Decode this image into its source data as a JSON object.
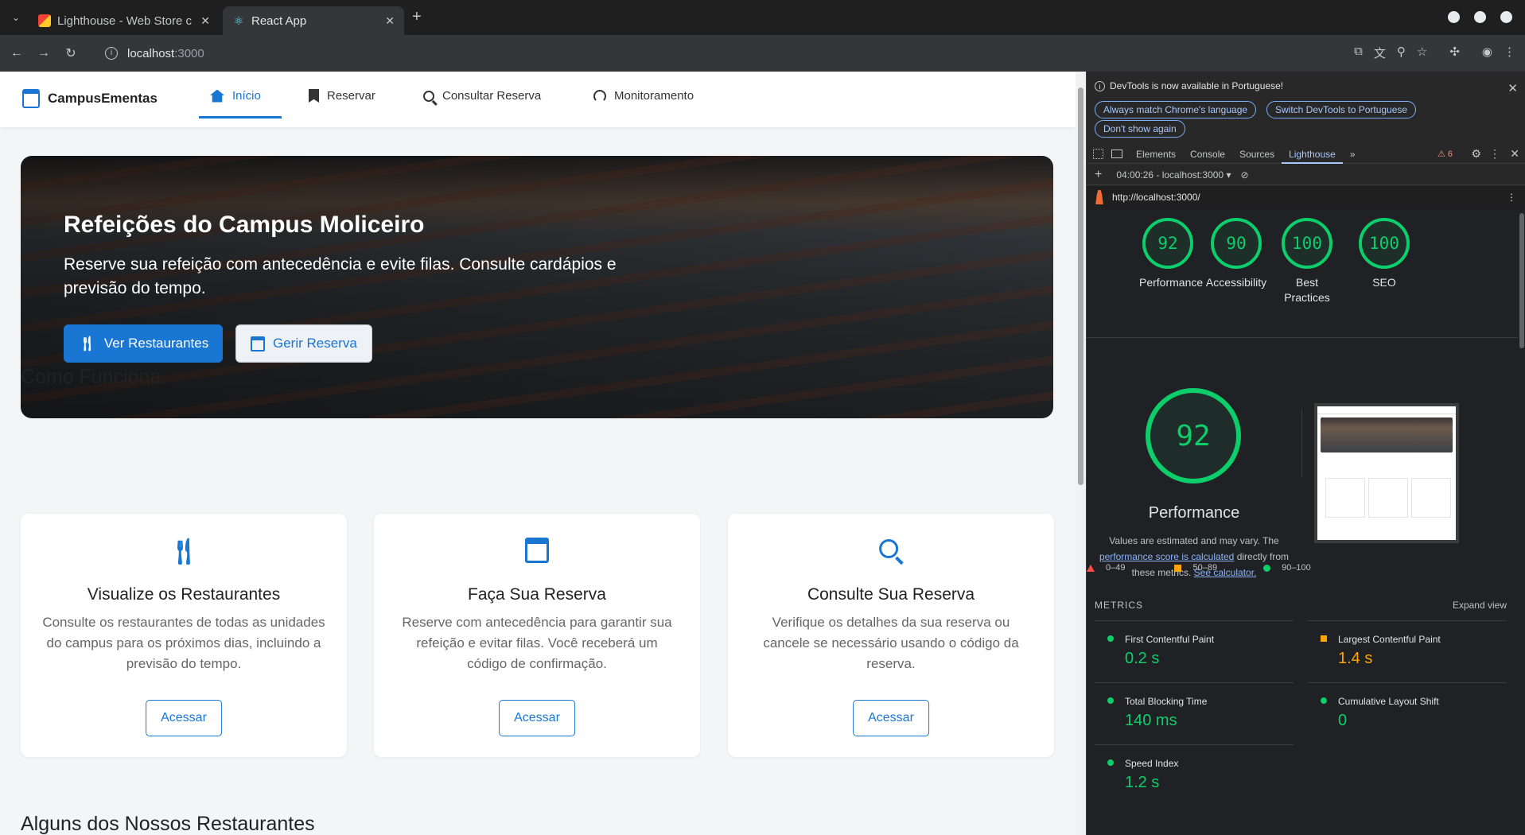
{
  "browser": {
    "tabs": [
      {
        "title": "Lighthouse - Web Store c",
        "active": false
      },
      {
        "title": "React App",
        "active": true
      }
    ],
    "url_host": "localhost",
    "url_port": ":3000"
  },
  "app": {
    "brand": "CampusEmentas",
    "nav": [
      {
        "label": "Início",
        "active": true
      },
      {
        "label": "Reservar",
        "active": false
      },
      {
        "label": "Consultar Reserva",
        "active": false
      },
      {
        "label": "Monitoramento",
        "active": false
      }
    ],
    "hero": {
      "title": "Refeições do Campus Moliceiro",
      "subtitle": "Reserve sua refeição com antecedência e evite filas. Consulte cardápios e previsão do tempo.",
      "primary_button": "Ver Restaurantes",
      "secondary_button": "Gerir Reserva"
    },
    "how_it_works_title": "Como Funciona",
    "cards": [
      {
        "title": "Visualize os Restaurantes",
        "text": "Consulte os restaurantes de todas as unidades do campus para os próximos dias, incluindo a previsão do tempo.",
        "button": "Acessar",
        "icon": "fork-knife-icon"
      },
      {
        "title": "Faça Sua Reserva",
        "text": "Reserve com antecedência para garantir sua refeição e evitar filas. Você receberá um código de confirmação.",
        "button": "Acessar",
        "icon": "calendar-check-icon"
      },
      {
        "title": "Consulte Sua Reserva",
        "text": "Verifique os detalhes da sua reserva ou cancele se necessário usando o código da reserva.",
        "button": "Acessar",
        "icon": "search-icon"
      }
    ],
    "restaurants_title": "Alguns dos Nossos Restaurantes"
  },
  "devtools": {
    "info_message": "DevTools is now available in Portuguese!",
    "info_buttons": [
      "Always match Chrome's language",
      "Switch DevTools to Portuguese",
      "Don't show again"
    ],
    "tabs": [
      "Elements",
      "Console",
      "Sources",
      "Lighthouse"
    ],
    "active_tab": "Lighthouse",
    "warnings": "6",
    "report_selector": "04:00:26 - localhost:3000",
    "report_url": "http://localhost:3000/",
    "scores": [
      {
        "label": "Performance",
        "value": "92"
      },
      {
        "label": "Accessibility",
        "value": "90"
      },
      {
        "label": "Best Practices",
        "value": "100"
      },
      {
        "label": "SEO",
        "value": "100"
      }
    ],
    "performance": {
      "score": "92",
      "title": "Performance",
      "note_prefix": "Values are estimated and may vary. The",
      "note_link": "performance score is calculated",
      "note_mid": "directly from these metrics.",
      "note_link2": "See calculator."
    },
    "legend": [
      "0–49",
      "50–89",
      "90–100"
    ],
    "metrics_header": "METRICS",
    "expand_label": "Expand view",
    "metrics": [
      {
        "name": "First Contentful Paint",
        "value": "0.2 s",
        "rating": "good"
      },
      {
        "name": "Largest Contentful Paint",
        "value": "1.4 s",
        "rating": "average"
      },
      {
        "name": "Total Blocking Time",
        "value": "140 ms",
        "rating": "good"
      },
      {
        "name": "Cumulative Layout Shift",
        "value": "0",
        "rating": "good"
      },
      {
        "name": "Speed Index",
        "value": "1.2 s",
        "rating": "good"
      }
    ],
    "colors": {
      "good": "#0cce6b",
      "average": "#ffa400",
      "poor": "#ff4e42"
    }
  }
}
